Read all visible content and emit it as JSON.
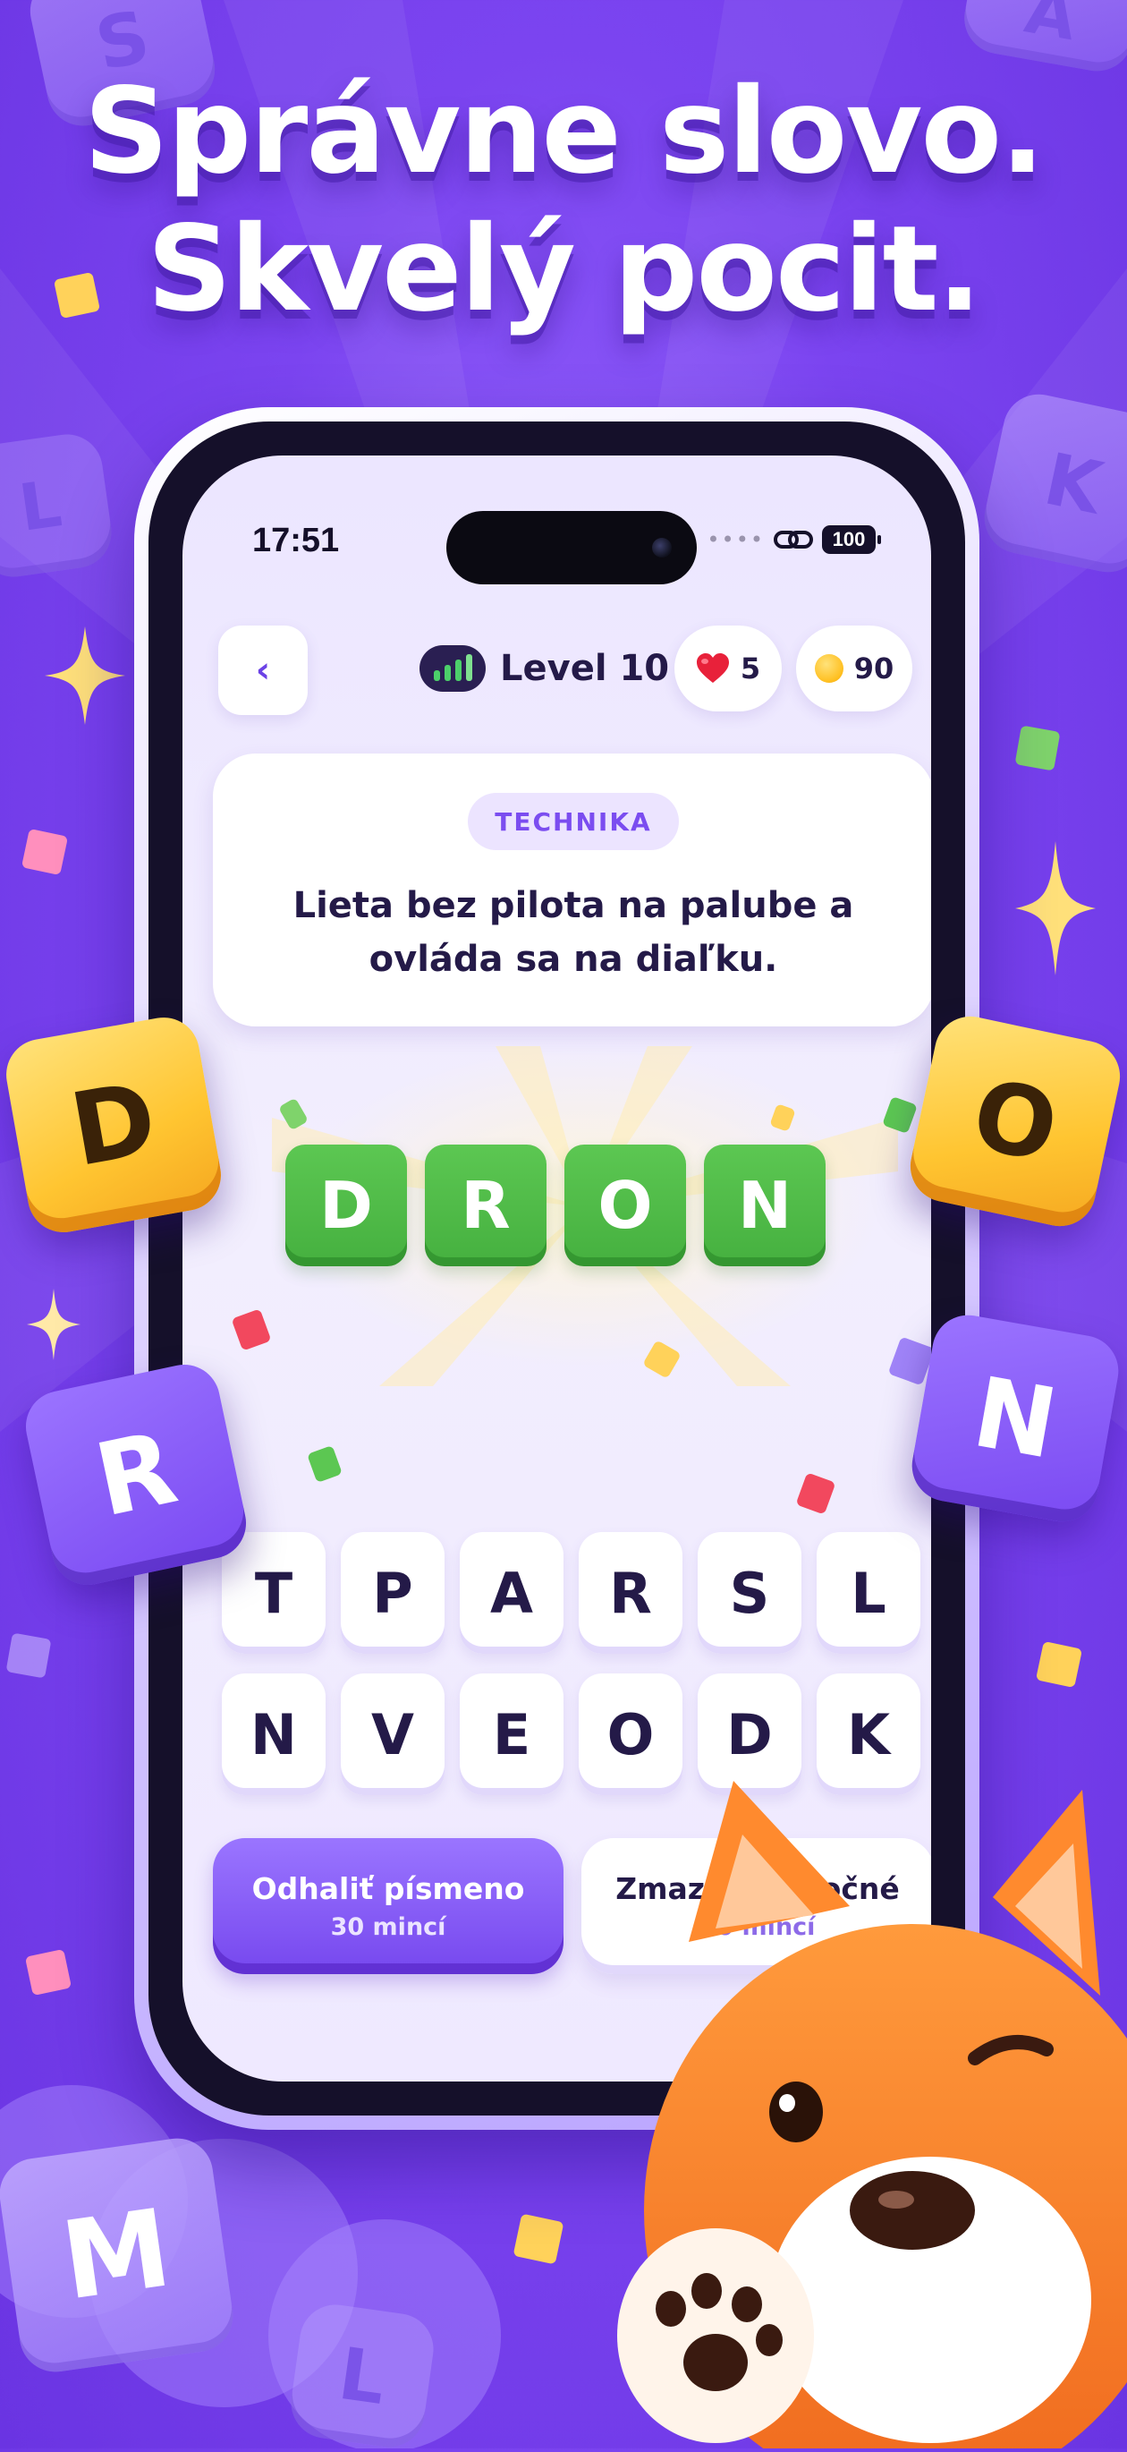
{
  "headline": {
    "line1": "Správne slovo.",
    "line2": "Skvelý pocit."
  },
  "decorative_tiles": {
    "top_left": "S",
    "top_right": "A",
    "left_upper": "L",
    "right_upper": "K",
    "yellow_left": "D",
    "yellow_right": "O",
    "purple_left": "R",
    "purple_right": "N",
    "bottom_left": "M",
    "bottom_center": "L"
  },
  "status_bar": {
    "time": "17:51",
    "battery": "100"
  },
  "top_bar": {
    "back_icon": "chevron-left-icon",
    "level_label": "Level 10",
    "lives_icon": "heart-icon",
    "lives": "5",
    "coins_icon": "coin-icon",
    "coins": "90"
  },
  "clue": {
    "category": "TECHNIKA",
    "text": "Lieta bez pilota na palube a ovláda sa na diaľku."
  },
  "answer": [
    "D",
    "R",
    "O",
    "N"
  ],
  "keyboard": {
    "row1": [
      "T",
      "P",
      "A",
      "R",
      "S",
      "L"
    ],
    "row2": [
      "N",
      "V",
      "E",
      "O",
      "D",
      "K"
    ]
  },
  "actions": {
    "reveal": {
      "title": "Odhaliť písmeno",
      "cost": "30 mincí"
    },
    "remove": {
      "title": "Zmazať zbytočné",
      "cost": "20 mincí"
    }
  },
  "colors": {
    "background": "#7b44f0",
    "accent": "#7647ee",
    "correct": "#4fbc47",
    "text_dark": "#241a48",
    "tile_yellow": "#ffc531"
  }
}
